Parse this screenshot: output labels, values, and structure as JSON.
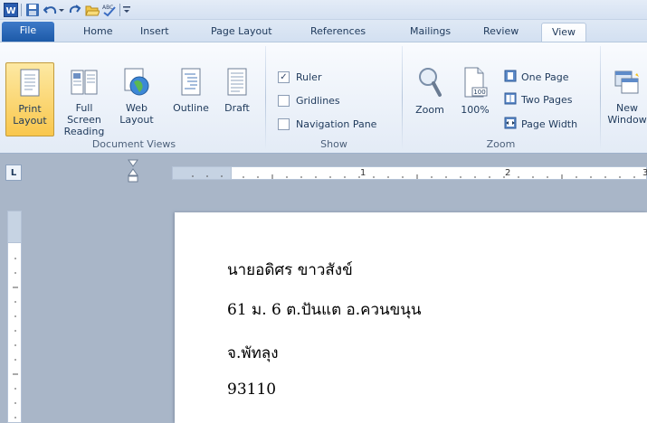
{
  "quick_access": {
    "icons": [
      "word-app-icon",
      "save-icon",
      "undo-icon",
      "redo-icon",
      "open-icon",
      "spelling-icon",
      "customize-qat-icon"
    ]
  },
  "tabs": [
    {
      "label": "File"
    },
    {
      "label": "Home"
    },
    {
      "label": "Insert"
    },
    {
      "label": "Page Layout"
    },
    {
      "label": "References"
    },
    {
      "label": "Mailings"
    },
    {
      "label": "Review"
    },
    {
      "label": "View"
    }
  ],
  "ribbon": {
    "document_views": {
      "label": "Document Views",
      "print_layout": [
        "Print",
        "Layout"
      ],
      "full_screen": [
        "Full Screen",
        "Reading"
      ],
      "web_layout": [
        "Web",
        "Layout"
      ],
      "outline": "Outline",
      "draft": "Draft"
    },
    "show": {
      "label": "Show",
      "ruler": "Ruler",
      "gridlines": "Gridlines",
      "nav_pane": "Navigation Pane",
      "ruler_checked": true,
      "gridlines_checked": false,
      "nav_pane_checked": false
    },
    "zoom": {
      "label": "Zoom",
      "zoom": "Zoom",
      "hundred": "100%",
      "hundred_icon_text": "100",
      "one_page": "One Page",
      "two_pages": "Two Pages",
      "page_width": "Page Width"
    },
    "window": {
      "new_window": [
        "New",
        "Window"
      ]
    }
  },
  "ruler": {
    "corner": "L",
    "h_numbers": [
      "1",
      "2",
      "3"
    ]
  },
  "document": {
    "lines": [
      "นายอดิศร ขาวสังข์",
      "61 ม. 6 ต.ปันแต อ.ควนขนุน",
      "จ.พัทลุง",
      "93110"
    ]
  },
  "colors": {
    "file_tab": "#2b67b8",
    "active_button": "#fbd56b",
    "workspace": "#a9b6c8"
  }
}
